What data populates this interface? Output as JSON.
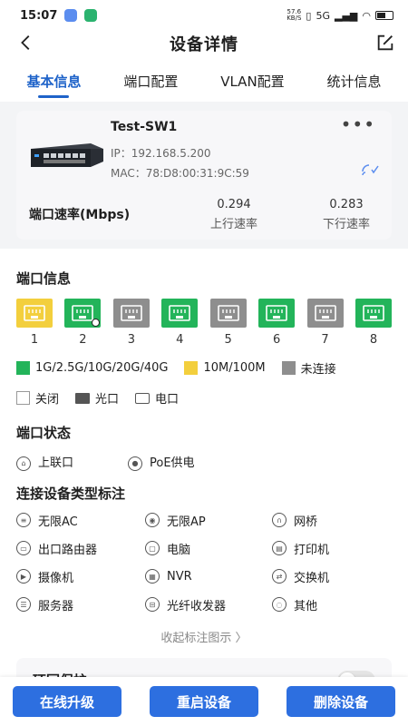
{
  "status": {
    "time": "15:07",
    "speed_top": "57.6",
    "speed_bottom": "KB/S",
    "network": "5G",
    "app_icon_colors": [
      "#5b8def",
      "#2bb36f"
    ]
  },
  "nav": {
    "title": "设备详情",
    "back_icon": "back-arrow-icon",
    "edit_icon": "edit-icon"
  },
  "tabs": [
    {
      "label": "基本信息",
      "active": true
    },
    {
      "label": "端口配置",
      "active": false
    },
    {
      "label": "VLAN配置",
      "active": false
    },
    {
      "label": "统计信息",
      "active": false
    }
  ],
  "device": {
    "name": "Test-SW1",
    "ip": "IP：192.168.5.200",
    "mac": "MAC：78:D8:00:31:9C:59",
    "more": "•••",
    "rate_label": "端口速率(Mbps)",
    "up_value": "0.294",
    "up_label": "上行速率",
    "down_value": "0.283",
    "down_label": "下行速率"
  },
  "port_info": {
    "title": "端口信息",
    "ports": [
      {
        "num": "1",
        "status": "yellow",
        "uplink": false
      },
      {
        "num": "2",
        "status": "green",
        "uplink": true
      },
      {
        "num": "3",
        "status": "gray",
        "uplink": false
      },
      {
        "num": "4",
        "status": "green",
        "uplink": false
      },
      {
        "num": "5",
        "status": "gray",
        "uplink": false
      },
      {
        "num": "6",
        "status": "green",
        "uplink": false
      },
      {
        "num": "7",
        "status": "gray",
        "uplink": false
      },
      {
        "num": "8",
        "status": "green",
        "uplink": false
      }
    ],
    "legend": {
      "fast": "1G/2.5G/10G/20G/40G",
      "slow": "10M/100M",
      "disconnected": "未连接",
      "closed": "关闭",
      "fiber": "光口",
      "electric": "电口"
    },
    "colors": {
      "green": "#23b45a",
      "yellow": "#f3cf3d",
      "gray": "#8e8e8e",
      "accent": "#1f63c9",
      "button": "#2d6fe0"
    }
  },
  "port_state": {
    "title": "端口状态",
    "uplink": "上联口",
    "poe": "PoE供电"
  },
  "device_types": {
    "title": "连接设备类型标注",
    "items": [
      "无限AC",
      "无限AP",
      "网桥",
      "出口路由器",
      "电脑",
      "打印机",
      "摄像机",
      "NVR",
      "交换机",
      "服务器",
      "光纤收发器",
      "其他"
    ],
    "collapse": "收起标注图示 〉"
  },
  "loop": {
    "title": "环回保护",
    "enabled": false
  },
  "actions": {
    "upgrade": "在线升级",
    "reboot": "重启设备",
    "delete": "删除设备"
  }
}
